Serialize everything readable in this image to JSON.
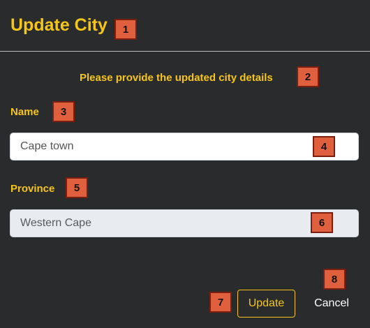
{
  "dialog": {
    "title": "Update City",
    "subtitle": "Please provide the updated city details"
  },
  "form": {
    "name_label": "Name",
    "name_value": "Cape town",
    "province_label": "Province",
    "province_value": "Western Cape"
  },
  "actions": {
    "update_label": "Update",
    "cancel_label": "Cancel"
  },
  "annotations": [
    "1",
    "2",
    "3",
    "4",
    "5",
    "6",
    "7",
    "8"
  ],
  "colors": {
    "accent": "#f5c518",
    "background": "#2a2b2d",
    "badge": "#e0603e"
  }
}
